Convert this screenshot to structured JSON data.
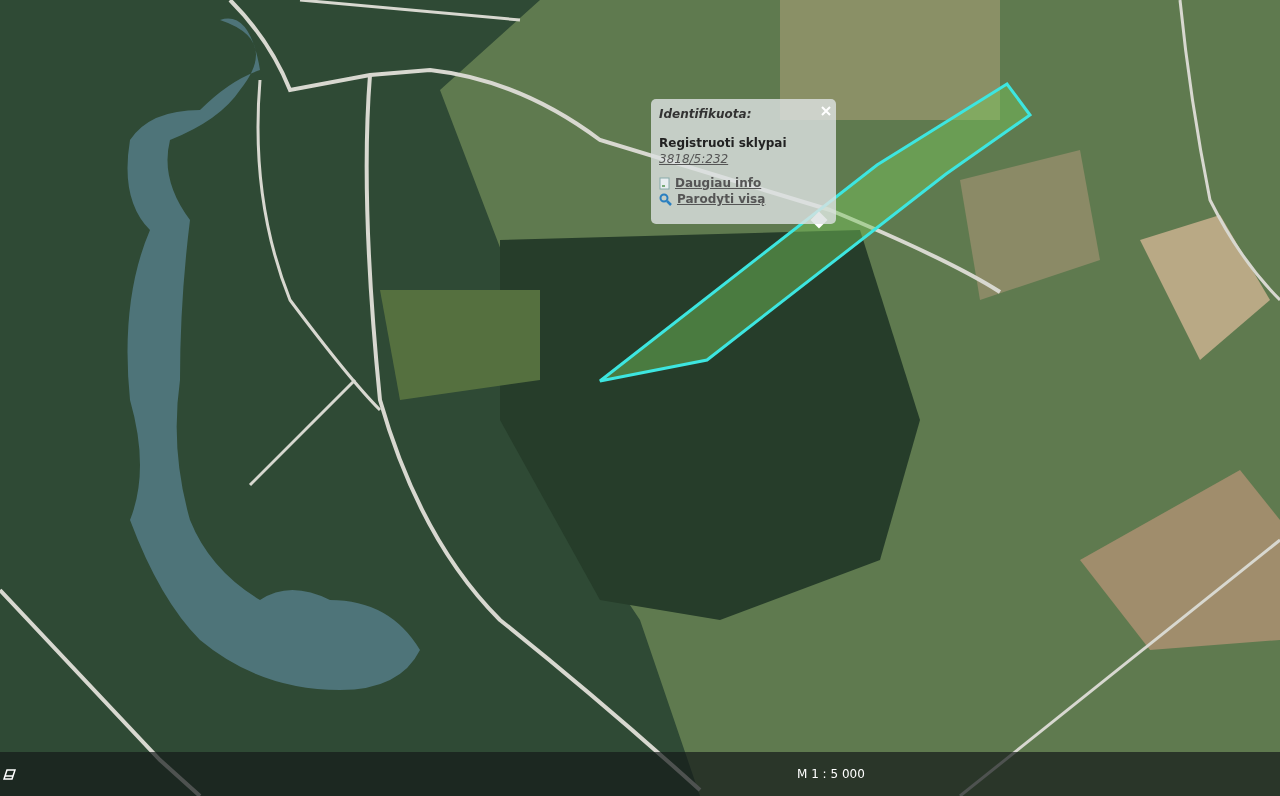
{
  "popup": {
    "title": "Identifikuota:",
    "layer": "Registruoti sklypai",
    "parcel_id": "3818/5:232",
    "links": [
      {
        "kind": "info",
        "label": "Daugiau info"
      },
      {
        "kind": "zoom",
        "label": "Parodyti visą"
      }
    ]
  },
  "status_bar": {
    "scale": "M 1 : 5 000"
  }
}
